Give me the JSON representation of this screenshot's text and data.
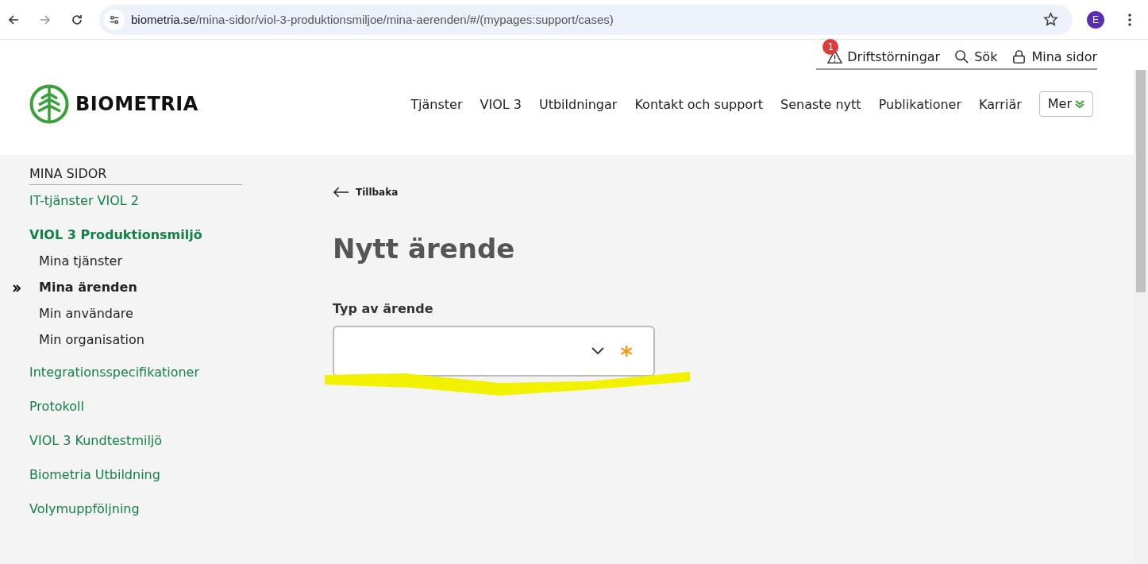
{
  "browser": {
    "url_host": "biometria.se",
    "url_path": "/mina-sidor/viol-3-produktionsmiljoe/mina-aerenden/#/(mypages:support/cases)",
    "avatar": "E"
  },
  "header": {
    "logo": "BIOMETRIA",
    "top_links": [
      {
        "kind": "alert",
        "label": "Driftstörningar",
        "badge": "1"
      },
      {
        "kind": "search",
        "label": "Sök"
      },
      {
        "kind": "lock",
        "label": "Mina sidor"
      }
    ],
    "nav": [
      "Tjänster",
      "VIOL 3",
      "Utbildningar",
      "Kontakt och support",
      "Senaste nytt",
      "Publikationer",
      "Karriär"
    ],
    "more": "Mer"
  },
  "sidebar": {
    "heading": "MINA SIDOR",
    "items": [
      {
        "label": "IT-tjänster VIOL 2",
        "expanded": false
      },
      {
        "label": "VIOL 3 Produktionsmiljö",
        "expanded": true,
        "children": [
          {
            "label": "Mina tjänster",
            "selected": false
          },
          {
            "label": "Mina ärenden",
            "selected": true
          },
          {
            "label": "Min användare",
            "selected": false
          },
          {
            "label": "Min organisation",
            "selected": false
          }
        ]
      },
      {
        "label": "Integrationsspecifikationer",
        "expanded": false
      },
      {
        "label": "Protokoll",
        "expanded": false
      },
      {
        "label": "VIOL 3 Kundtestmiljö",
        "expanded": false
      },
      {
        "label": "Biometria Utbildning",
        "expanded": false
      },
      {
        "label": "Volymuppföljning",
        "expanded": false
      }
    ]
  },
  "main": {
    "back": "Tillbaka",
    "title": "Nytt ärende",
    "field_label": "Typ av ärende",
    "required_mark": "*"
  }
}
